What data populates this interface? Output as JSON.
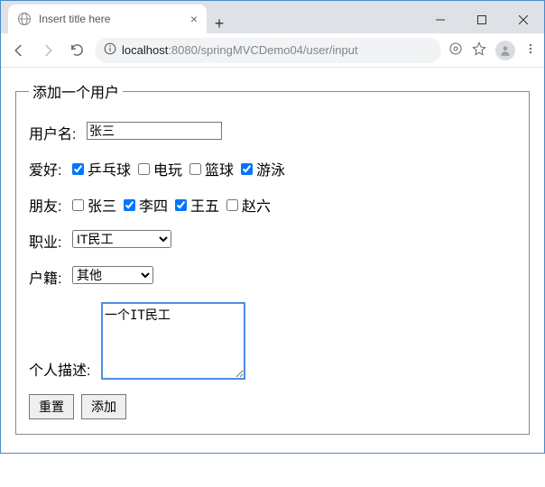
{
  "window": {
    "tab_title": "Insert title here"
  },
  "toolbar": {
    "url_scheme_host": "localhost",
    "url_port": ":8080",
    "url_path": "/springMVCDemo04/user/input"
  },
  "form": {
    "legend": "添加一个用户",
    "username_label": "用户名:",
    "username_value": "张三",
    "hobby_label": "爱好:",
    "hobbies": [
      {
        "label": "乒乓球",
        "checked": true
      },
      {
        "label": "电玩",
        "checked": false
      },
      {
        "label": "篮球",
        "checked": false
      },
      {
        "label": "游泳",
        "checked": true
      }
    ],
    "friends_label": "朋友:",
    "friends": [
      {
        "label": "张三",
        "checked": false
      },
      {
        "label": "李四",
        "checked": true
      },
      {
        "label": "王五",
        "checked": true
      },
      {
        "label": "赵六",
        "checked": false
      }
    ],
    "job_label": "职业:",
    "job_value": "IT民工",
    "origin_label": "户籍:",
    "origin_value": "其他",
    "desc_label": "个人描述:",
    "desc_value": "一个IT民工",
    "reset_label": "重置",
    "submit_label": "添加"
  }
}
